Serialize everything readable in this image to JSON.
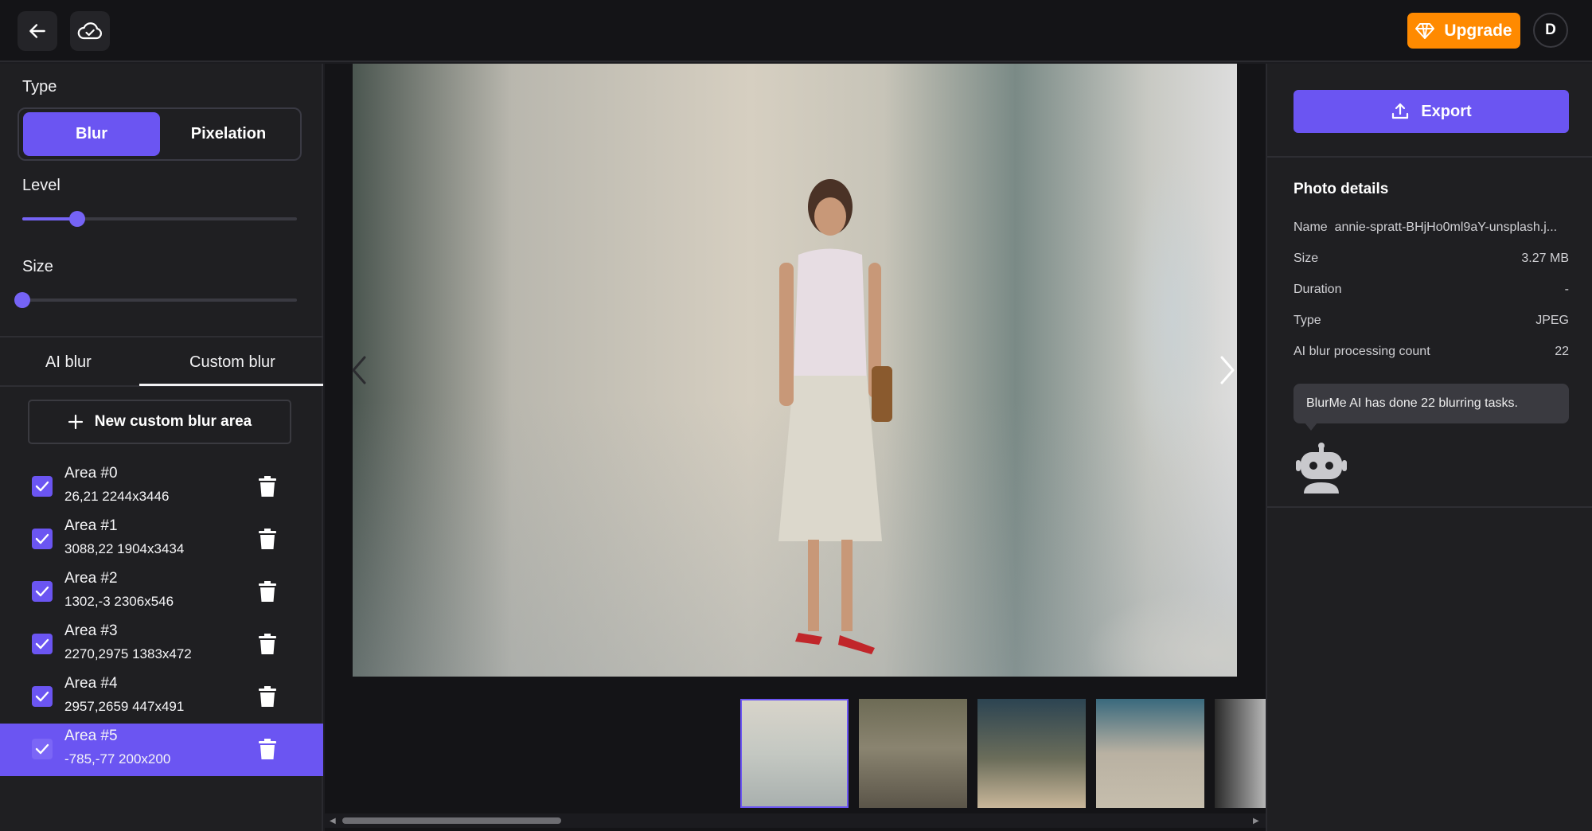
{
  "topbar": {
    "back_icon": "arrow-left-icon",
    "cloud_icon": "cloud-check-icon",
    "upgrade_label": "Upgrade",
    "upgrade_icon": "diamond-icon",
    "avatar_initial": "D",
    "accent_color": "#ff8a00"
  },
  "left": {
    "type_label": "Type",
    "type_options": [
      "Blur",
      "Pixelation"
    ],
    "type_selected": "Blur",
    "level_label": "Level",
    "level_value": 0.2,
    "size_label": "Size",
    "size_value": 0.0,
    "tabs": [
      "AI blur",
      "Custom blur"
    ],
    "active_tab": "Custom blur",
    "new_area_label": "New custom blur area",
    "areas": [
      {
        "name": "Area #0",
        "coords": "26,21 2244x3446",
        "checked": true
      },
      {
        "name": "Area #1",
        "coords": "3088,22 1904x3434",
        "checked": true
      },
      {
        "name": "Area #2",
        "coords": "1302,-3 2306x546",
        "checked": true
      },
      {
        "name": "Area #3",
        "coords": "2270,2975 1383x472",
        "checked": true
      },
      {
        "name": "Area #4",
        "coords": "2957,2659 447x491",
        "checked": true
      },
      {
        "name": "Area #5",
        "coords": "-785,-77 200x200",
        "checked": true
      }
    ],
    "selected_area": "Area #5",
    "accent_color": "#6b55f2"
  },
  "right": {
    "export_label": "Export",
    "export_icon": "upload-icon",
    "details_title": "Photo details",
    "details": [
      {
        "key": "Name",
        "value": "annie-spratt-BHjHo0ml9aY-unsplash.j..."
      },
      {
        "key": "Size",
        "value": "3.27 MB"
      },
      {
        "key": "Duration",
        "value": "-"
      },
      {
        "key": "Type",
        "value": "JPEG"
      },
      {
        "key": "AI blur processing count",
        "value": "22"
      }
    ],
    "bubble_text": "BlurMe AI has done 22 blurring tasks.",
    "robot_icon": "robot-icon"
  }
}
